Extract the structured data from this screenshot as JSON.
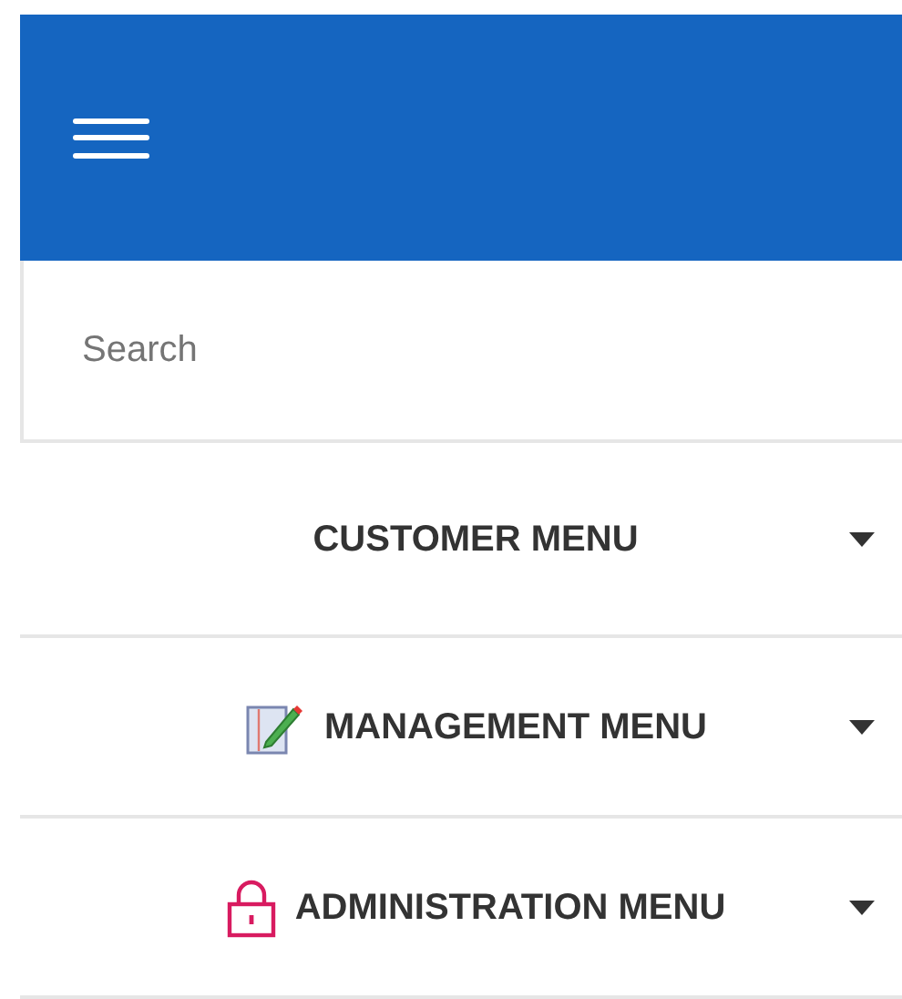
{
  "search": {
    "placeholder": "Search"
  },
  "menu_items": [
    {
      "label": "CUSTOMER MENU",
      "kind": "plain",
      "expanded": false
    },
    {
      "label": "MANAGEMENT MENU",
      "kind": "edit",
      "expanded": false
    },
    {
      "label": "ADMINISTRATION MENU",
      "kind": "lock",
      "expanded": false
    }
  ]
}
